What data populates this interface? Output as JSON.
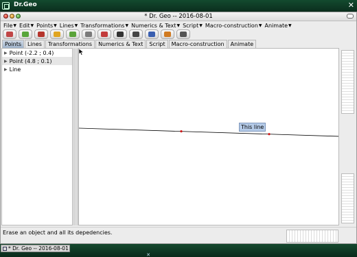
{
  "os": {
    "window_title": "Dr.Geo",
    "close_label": "✕"
  },
  "app": {
    "title": "* Dr. Geo --  2016-08-01",
    "menu": [
      {
        "label": "File"
      },
      {
        "label": "Edit"
      },
      {
        "label": "Points"
      },
      {
        "label": "Lines"
      },
      {
        "label": "Transformations"
      },
      {
        "label": "Numerics & Text"
      },
      {
        "label": "Script"
      },
      {
        "label": "Macro-construction"
      },
      {
        "label": "Animate"
      }
    ],
    "toolbar": [
      {
        "icon": "browse-icon",
        "color": "#c04646"
      },
      {
        "icon": "open-icon",
        "color": "#58a63a"
      },
      {
        "icon": "save-icon",
        "color": "#b5352d"
      },
      {
        "icon": "undo-icon",
        "color": "#e0a521"
      },
      {
        "icon": "redo-icon",
        "color": "#5aa33a"
      },
      {
        "icon": "grid-icon",
        "color": "#7a7a7a"
      },
      {
        "icon": "erase-icon",
        "color": "#c23b3b"
      },
      {
        "icon": "move-icon",
        "color": "#333333"
      },
      {
        "icon": "scale-icon",
        "color": "#444444"
      },
      {
        "icon": "style-icon",
        "color": "#3a5fb0"
      },
      {
        "icon": "color-icon",
        "color": "#d07a20"
      },
      {
        "icon": "edit-icon",
        "color": "#555555"
      }
    ],
    "tabs": [
      {
        "label": "Points",
        "active": true
      },
      {
        "label": "Lines",
        "active": false
      },
      {
        "label": "Transformations",
        "active": false
      },
      {
        "label": "Numerics & Text",
        "active": false
      },
      {
        "label": "Script",
        "active": false
      },
      {
        "label": "Macro-construction",
        "active": false
      },
      {
        "label": "Animate",
        "active": false
      }
    ],
    "tree": [
      {
        "label": "Point  (-2.2 ; 0.4)"
      },
      {
        "label": "Point  (4.8 ; 0.1)"
      },
      {
        "label": "Line"
      }
    ],
    "tooltip": "This line",
    "status": "Erase an object and all its depedencies."
  },
  "taskbar": {
    "task_label": "* Dr. Geo --  2016-08-01"
  }
}
